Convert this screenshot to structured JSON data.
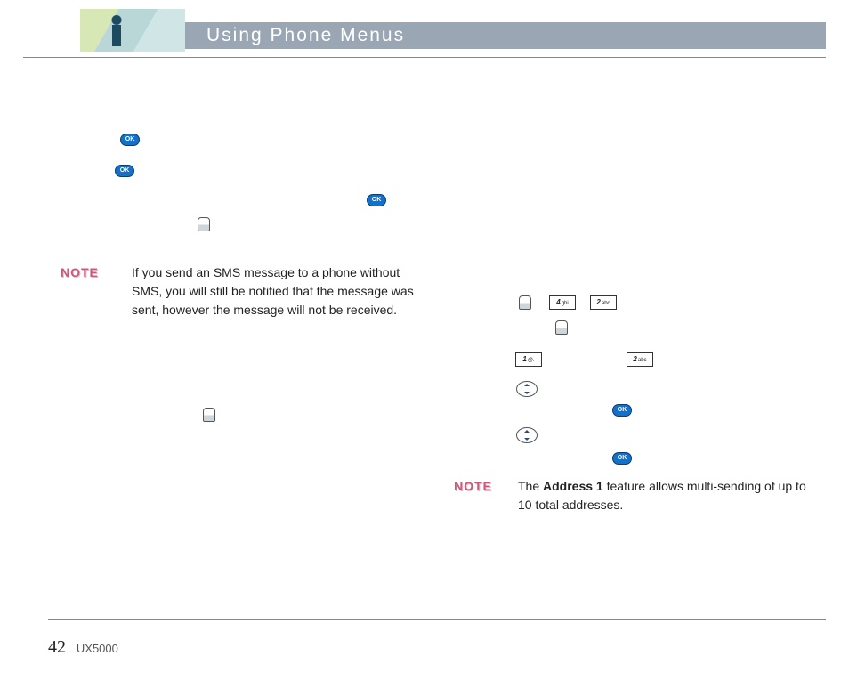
{
  "header": {
    "title": "Using Phone Menus"
  },
  "icons": {
    "ok_label": "OK",
    "key_4ghi": "4",
    "key_4ghi_sub": "ghi",
    "key_2abc": "2",
    "key_2abc_sub": "abc",
    "key_1": "1",
    "key_1_sub": "@.",
    "key_2abc_b": "2",
    "key_2abc_b_sub": "abc"
  },
  "notes": {
    "left_label": "NOTE",
    "left_body": "If you send an SMS message to a phone without SMS, you will still be notified that the message was sent, however the message will not be received.",
    "right_label": "NOTE",
    "right_prefix": "The ",
    "right_bold": "Address 1",
    "right_suffix": " feature allows multi-sending of up to 10 total addresses."
  },
  "footer": {
    "page_number": "42",
    "model": "UX5000"
  }
}
